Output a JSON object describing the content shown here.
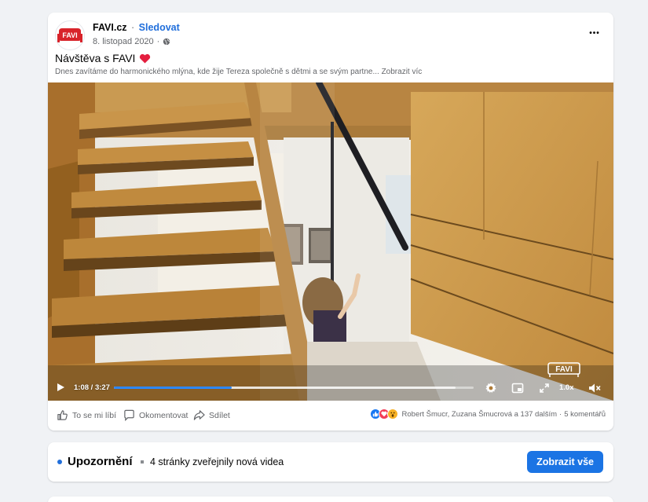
{
  "post": {
    "author": "FAVI.cz",
    "separator": "·",
    "follow_label": "Sledovat",
    "date": "8. listopad 2020",
    "dot": "·",
    "more_options_label": "•••",
    "title": "Návštěva s FAVI",
    "text": "Dnes zavítáme do harmonického mlýna, kde žije Tereza společně s dětmi a se svým partne...",
    "show_more_label": "Zobrazit víc",
    "avatar_logo_text": "FAVI",
    "icons": {
      "avatar": "favi-logo",
      "privacy": "globe-icon",
      "title_emoji": "red-heart"
    }
  },
  "video": {
    "current_time": "1:08",
    "time_separator": " / ",
    "duration": "3:27",
    "progress": 0.328,
    "buffered": 0.95,
    "speed": "1.0x",
    "watermark_text": "FAVI",
    "icons": [
      "play-icon",
      "settings-icon",
      "picture-in-picture-icon",
      "fullscreen-icon",
      "volume-muted-icon"
    ]
  },
  "actions": {
    "like_label": "To se mi líbí",
    "comment_label": "Okomentovat",
    "share_label": "Sdílet",
    "reactions_text": "Robert Šmucr, Zuzana Šmucrová a 137 dalším",
    "reactions_sep": "·",
    "comments_count": "5 komentářů",
    "reaction_icons": [
      "like",
      "love",
      "wow"
    ],
    "colors": {
      "like": "#1877f2",
      "love": "#f33e58",
      "wow": "#f7b125"
    }
  },
  "notice": {
    "title": "Upozornění",
    "text": "4 stránky zveřejnily nová videa",
    "button_label": "Zobrazit vše"
  },
  "colors": {
    "accent": "#1b74e4",
    "background": "#f0f2f5",
    "secondary_text": "#65676b",
    "progress": "#2d88ff"
  }
}
